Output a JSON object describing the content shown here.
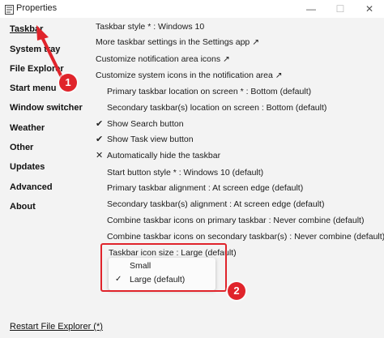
{
  "window": {
    "title": "Properties",
    "controls": {
      "minimize": "—",
      "maximize": "☐",
      "close": "✕"
    }
  },
  "sidebar": {
    "items": [
      {
        "label": "Taskbar",
        "active": true
      },
      {
        "label": "System tray"
      },
      {
        "label": "File Explorer"
      },
      {
        "label": "Start menu"
      },
      {
        "label": "Window switcher"
      },
      {
        "label": "Weather"
      },
      {
        "label": "Other"
      },
      {
        "label": "Updates"
      },
      {
        "label": "Advanced"
      },
      {
        "label": "About"
      }
    ],
    "footer_link": "Restart File Explorer (*)"
  },
  "content": {
    "taskbar_style": "Taskbar style * : Windows 10",
    "more_settings": "More taskbar settings in the Settings app ↗",
    "customize_notification": "Customize notification area icons ↗",
    "customize_system": "Customize system icons in the notification area ↗",
    "primary_location": "Primary taskbar location on screen * : Bottom (default)",
    "secondary_location": "Secondary taskbar(s) location on screen : Bottom (default)",
    "show_search": {
      "mark": "✔",
      "label": "Show Search button"
    },
    "show_taskview": {
      "mark": "✔",
      "label": "Show Task view button"
    },
    "auto_hide": {
      "mark": "✕",
      "label": "Automatically hide the taskbar"
    },
    "start_button_style": "Start button style * : Windows 10 (default)",
    "primary_alignment": "Primary taskbar alignment : At screen edge (default)",
    "secondary_alignment": "Secondary taskbar(s) alignment : At screen edge (default)",
    "combine_primary": "Combine taskbar icons on primary taskbar : Never combine (default)",
    "combine_secondary": "Combine taskbar icons on secondary taskbar(s) : Never combine (default)",
    "icon_size": "Taskbar icon size : Large (default)"
  },
  "icon_size_dropdown": {
    "options": [
      "Small",
      "Large (default)"
    ],
    "selected": "Large (default)",
    "check": "✓"
  },
  "annotations": {
    "step1": "1",
    "step2": "2",
    "color": "#e0242b"
  }
}
